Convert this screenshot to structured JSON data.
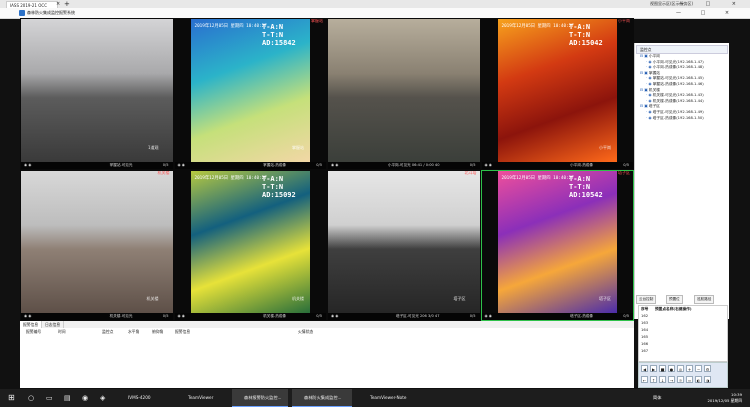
{
  "browser": {
    "tab_title": "IASS 2019-21 OCC",
    "tab_close": "×",
    "new_tab": "+",
    "window_controls": "— □ ×"
  },
  "app": {
    "title": "森林防火集成监控报警系统",
    "top_right": "视图显示区(区示服务区)",
    "window_controls": "— □ ×"
  },
  "cameras": [
    {
      "id": "c1",
      "label": "",
      "bar_left": "",
      "bar_mid": "掌握站-可见光",
      "bar_num": "0/5",
      "watermark": "1道观",
      "colors": [
        "#a9a9ab",
        "#d4d4d6",
        "#5c5c5c",
        "#3a3a3a"
      ]
    },
    {
      "id": "c2",
      "label": "掌握站",
      "date": "2019年12月05日 星期四 10:40:27",
      "line1": "T-A:N",
      "line2": "T-T:N",
      "line3": "AD:15842",
      "bar_left": "",
      "bar_mid": "掌握站-热成像",
      "bar_num": "0/5",
      "watermark": "掌握站",
      "colors": [
        "#2bb3c9",
        "#2a6ecf",
        "#c5e07a",
        "#f2d7a6"
      ]
    },
    {
      "id": "c3",
      "label": "",
      "bar_left": "",
      "bar_mid": "小平岗-可见光  06:41 / 0:00 40",
      "bar_num": "0/5",
      "watermark": "",
      "colors": [
        "#8a8172",
        "#b7ae9c",
        "#55524c",
        "#3b3f3a"
      ]
    },
    {
      "id": "c4",
      "label": "小平岗",
      "date": "2019年12月05日 星期四 10:40:27",
      "line1": "T-A:N",
      "line2": "T-T:N",
      "line3": "AD:15042",
      "bar_left": "",
      "bar_mid": "小平岗-热成像",
      "bar_num": "0/5",
      "watermark": "小平岗",
      "colors": [
        "#d33a12",
        "#f7a21d",
        "#8c140c",
        "#ff6a1a"
      ]
    },
    {
      "id": "c5",
      "label": "机关楼",
      "bar_left": "",
      "bar_mid": "机关楼-可见光",
      "bar_num": "0/5",
      "watermark": "机关楼",
      "colors": [
        "#bdbdbd",
        "#d8d8d8",
        "#8f8075",
        "#5e5048"
      ]
    },
    {
      "id": "c6",
      "label": "",
      "date": "2019年12月05日 星期四 10:40:27",
      "line1": "T-A:N",
      "line2": "T-T:N",
      "line3": "AD:15092",
      "bar_left": "",
      "bar_mid": "机关楼-热成像",
      "bar_num": "0/5",
      "watermark": "机关楼",
      "colors": [
        "#13607e",
        "#b7c940",
        "#e7e239",
        "#286e3a"
      ]
    },
    {
      "id": "c7",
      "label": "北斗塔",
      "bar_left": "",
      "bar_mid": "塔子区-可见光  206 3/0 47",
      "bar_num": "0/5",
      "watermark": "塔子区",
      "colors": [
        "#d0d0d0",
        "#e6e6e6",
        "#3f3f3f",
        "#262626"
      ]
    },
    {
      "id": "c8",
      "label": "塔子区",
      "date": "2019年12月05日 星期四 10:40:27",
      "line1": "T-A:N",
      "line2": "T-T:N",
      "line3": "AD:10542",
      "bar_left": "",
      "bar_mid": "塔子区-热成像",
      "bar_num": "0/5",
      "watermark": "塔子区",
      "colors": [
        "#8b2fb9",
        "#ef4f9b",
        "#f6a73a",
        "#4b2caa"
      ]
    }
  ],
  "right_panel": {
    "tab_label": "监控点",
    "tree": [
      {
        "text": "小平岗",
        "level": 0
      },
      {
        "text": "小平岗-可见光(192.168.1.47)",
        "level": 1
      },
      {
        "text": "小平岗-热成像(192.168.1.48)",
        "level": 1
      },
      {
        "text": "掌握站",
        "level": 0
      },
      {
        "text": "掌握站-可见光(192.168.1.45)",
        "level": 1
      },
      {
        "text": "掌握站-热成像(192.168.1.46)",
        "level": 1
      },
      {
        "text": "机关楼",
        "level": 0
      },
      {
        "text": "机关楼-可见光(192.168.1.43)",
        "level": 1
      },
      {
        "text": "机关楼-热成像(192.168.1.44)",
        "level": 1
      },
      {
        "text": "塔子区",
        "level": 0
      },
      {
        "text": "塔子区-可见光(192.168.1.49)",
        "level": 1
      },
      {
        "text": "塔子区-热成像(192.168.1.50)",
        "level": 1
      }
    ],
    "buttons": [
      "云台控制",
      "预置位",
      "巡航路径"
    ],
    "table_headers": [
      "序号",
      "预置点名称(右键操作)"
    ],
    "table_rows": [
      "162",
      "163",
      "164",
      "165",
      "166",
      "167"
    ]
  },
  "bottom_panel": {
    "tabs": [
      "报警信息",
      "日志信息"
    ],
    "columns": [
      "报警编号",
      "时间",
      "监控点",
      "水平角",
      "俯仰角",
      "报警信息",
      "火情状态"
    ]
  },
  "taskbar": {
    "items": [
      "IVMS-4200",
      "TeamViewer",
      "森林报警防火监控...",
      "森林防火集成监控...",
      "TeamViewer-Note"
    ],
    "tray_text": "简体",
    "time": "10:39",
    "date": "2019/12/05 星期四"
  }
}
